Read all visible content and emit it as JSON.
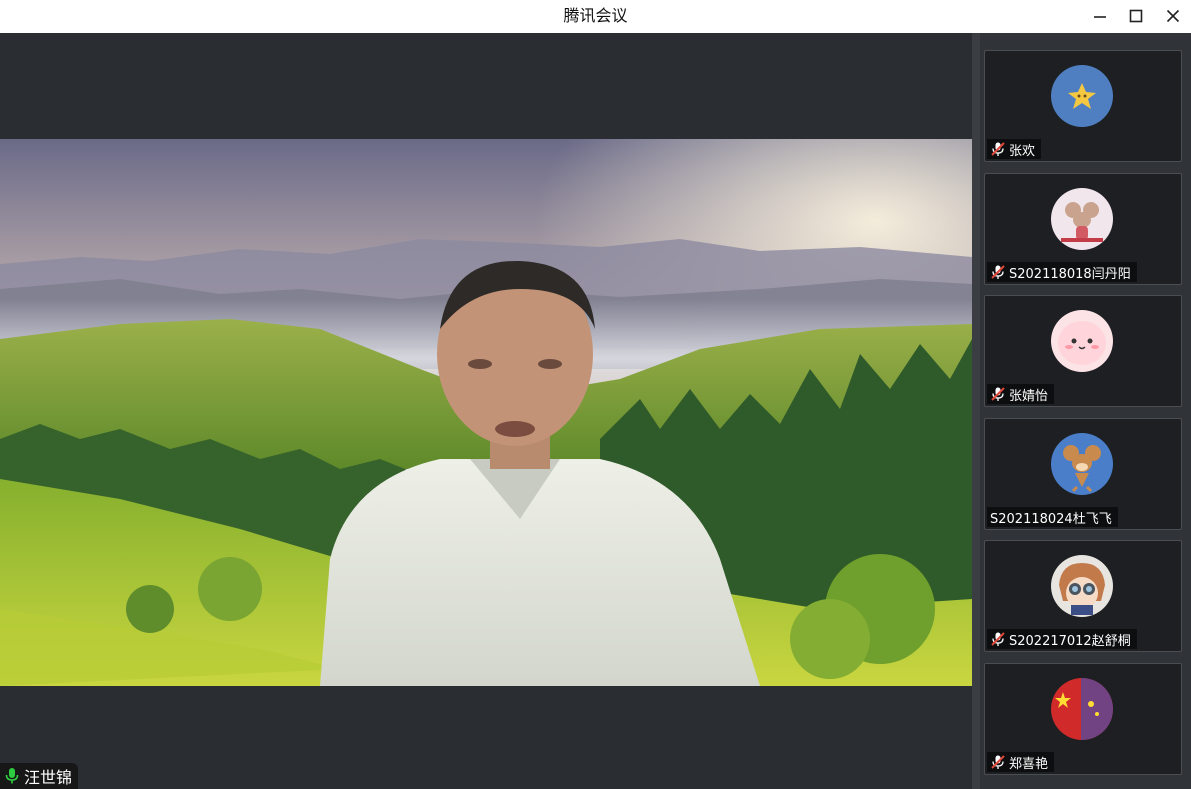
{
  "window": {
    "title": "腾讯会议"
  },
  "speaker": {
    "name": "汪世锦"
  },
  "participants": [
    {
      "name": "张欢",
      "avatar_icon": "star-avatar-icon",
      "muted": true
    },
    {
      "name": "S202118018闫丹阳",
      "avatar_icon": "cartoon-mouse-avatar-icon",
      "muted": true
    },
    {
      "name": "张婧怡",
      "avatar_icon": "pink-blob-avatar-icon",
      "muted": true
    },
    {
      "name": "S202118024杜飞飞",
      "avatar_icon": "jerry-avatar-icon",
      "muted": false
    },
    {
      "name": "S202217012赵舒桐",
      "avatar_icon": "anime-binoculars-avatar-icon",
      "muted": true
    },
    {
      "name": "郑喜艳",
      "avatar_icon": "flag-avatar-icon",
      "muted": true
    }
  ],
  "colors": {
    "mic_on": "#2ecc40",
    "mic_off": "#e0473a",
    "panel_bg": "#303338"
  }
}
